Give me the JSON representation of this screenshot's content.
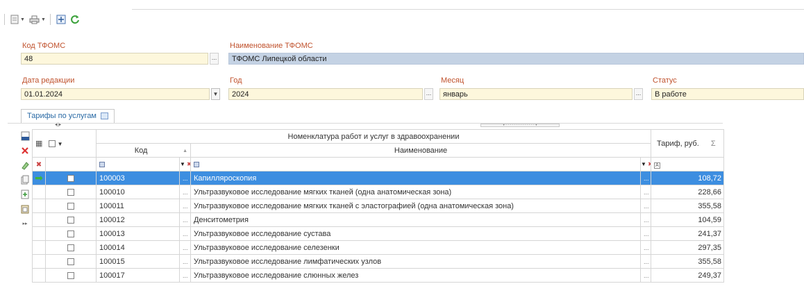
{
  "toolbar": {
    "buttons": [
      {
        "icon": "document-icon",
        "has_dropdown": true
      },
      {
        "icon": "printer-icon",
        "has_dropdown": true
      },
      {
        "icon": "expand-icon",
        "has_dropdown": false
      },
      {
        "icon": "refresh-icon",
        "has_dropdown": false
      }
    ]
  },
  "form": {
    "kod_tfoms": {
      "label": "Код ТФОМС",
      "value": "48"
    },
    "naim_tfoms": {
      "label": "Наименование ТФОМС",
      "value": "ТФОМС Липецкой области"
    },
    "data_red": {
      "label": "Дата редакции",
      "value": "01.01.2024"
    },
    "god": {
      "label": "Год",
      "value": "2024"
    },
    "mesyac": {
      "label": "Месяц",
      "value": "январь"
    },
    "status": {
      "label": "Статус",
      "value": "В работе"
    },
    "ellipsis": "..."
  },
  "tabs": [
    {
      "label": "Тарифы по услугам",
      "active": true
    }
  ],
  "grid": {
    "group_header": "Номенклатура работ и услуг в здравоохранении",
    "col_kod": "Код",
    "col_naim": "Наименование",
    "col_tarif": "Тариф, руб.",
    "sigma": "Σ",
    "rows": [
      {
        "kod": "100003",
        "naim": "Капилляроскопия",
        "tarif": "108,72",
        "selected": true
      },
      {
        "kod": "100010",
        "naim": "Ультразвуковое исследование мягких тканей (одна анатомическая зона)",
        "tarif": "228,66",
        "selected": false
      },
      {
        "kod": "100011",
        "naim": "Ультразвуковое исследование мягких тканей с эластографией (одна анатомическая зона)",
        "tarif": "355,58",
        "selected": false
      },
      {
        "kod": "100012",
        "naim": "Денситометрия",
        "tarif": "104,59",
        "selected": false
      },
      {
        "kod": "100013",
        "naim": "Ультразвуковое исследование сустава",
        "tarif": "241,37",
        "selected": false
      },
      {
        "kod": "100014",
        "naim": "Ультразвуковое исследование селезенки",
        "tarif": "297,35",
        "selected": false
      },
      {
        "kod": "100015",
        "naim": "Ультразвуковое исследование лимфатических узлов",
        "tarif": "355,58",
        "selected": false
      },
      {
        "kod": "100017",
        "naim": "Ультразвуковое исследование слюнных желез",
        "tarif": "249,37",
        "selected": false
      }
    ]
  },
  "colors": {
    "label": "#c0522d",
    "field_bg": "#fdf7dc",
    "field_blue": "#c4d2e4",
    "selection": "#3d8ee0",
    "tab_text": "#2a6aa5"
  }
}
